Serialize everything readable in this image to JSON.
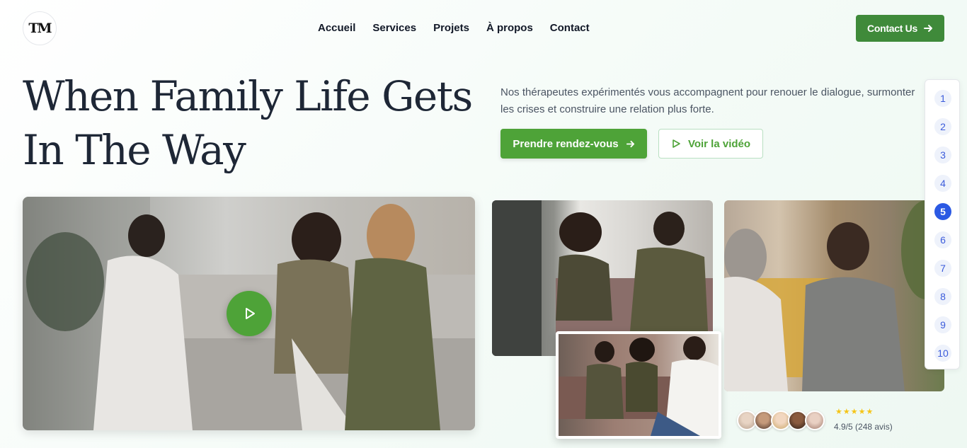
{
  "logo": {
    "text": "TM"
  },
  "nav": {
    "items": [
      "Accueil",
      "Services",
      "Projets",
      "À propos",
      "Contact"
    ]
  },
  "header": {
    "contact_label": "Contact Us"
  },
  "hero": {
    "title_line1": "When Family Life Gets",
    "title_line2": "In The Way",
    "description": "Nos thérapeutes expérimentés vous accompagnent pour renouer le dialogue, surmonter les crises et construire une relation plus forte.",
    "primary_cta": "Prendre rendez-vous",
    "secondary_cta": "Voir la vidéo"
  },
  "rating": {
    "stars": "★★★★★",
    "text": "4.9/5 (248 avis)"
  },
  "pager": {
    "pages": [
      "1",
      "2",
      "3",
      "4",
      "5",
      "6",
      "7",
      "8",
      "9",
      "10"
    ],
    "active": "5"
  },
  "colors": {
    "accent": "#4ea338",
    "contact_button": "#3f8a3a",
    "pager_active": "#2b59e3"
  },
  "icons": [
    "arrow-right-icon",
    "play-icon"
  ]
}
